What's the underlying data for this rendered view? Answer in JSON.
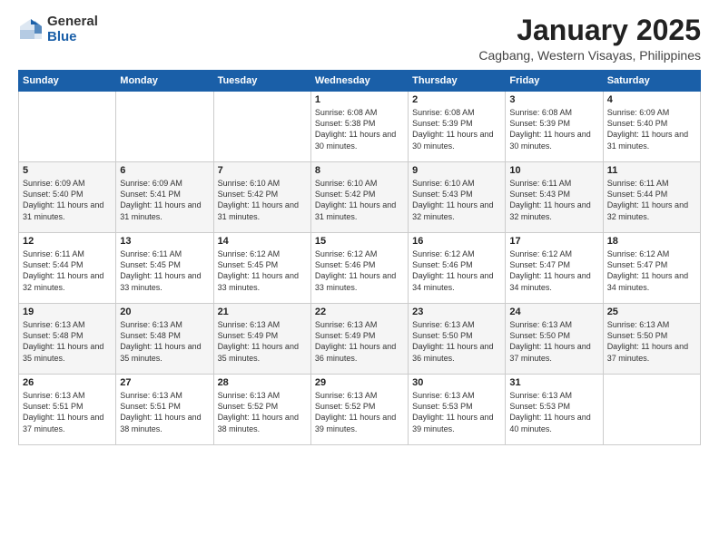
{
  "header": {
    "logo_general": "General",
    "logo_blue": "Blue",
    "month_title": "January 2025",
    "location": "Cagbang, Western Visayas, Philippines"
  },
  "weekdays": [
    "Sunday",
    "Monday",
    "Tuesday",
    "Wednesday",
    "Thursday",
    "Friday",
    "Saturday"
  ],
  "weeks": [
    [
      {
        "day": "",
        "sunrise": "",
        "sunset": "",
        "daylight": ""
      },
      {
        "day": "",
        "sunrise": "",
        "sunset": "",
        "daylight": ""
      },
      {
        "day": "",
        "sunrise": "",
        "sunset": "",
        "daylight": ""
      },
      {
        "day": "1",
        "sunrise": "Sunrise: 6:08 AM",
        "sunset": "Sunset: 5:38 PM",
        "daylight": "Daylight: 11 hours and 30 minutes."
      },
      {
        "day": "2",
        "sunrise": "Sunrise: 6:08 AM",
        "sunset": "Sunset: 5:39 PM",
        "daylight": "Daylight: 11 hours and 30 minutes."
      },
      {
        "day": "3",
        "sunrise": "Sunrise: 6:08 AM",
        "sunset": "Sunset: 5:39 PM",
        "daylight": "Daylight: 11 hours and 30 minutes."
      },
      {
        "day": "4",
        "sunrise": "Sunrise: 6:09 AM",
        "sunset": "Sunset: 5:40 PM",
        "daylight": "Daylight: 11 hours and 31 minutes."
      }
    ],
    [
      {
        "day": "5",
        "sunrise": "Sunrise: 6:09 AM",
        "sunset": "Sunset: 5:40 PM",
        "daylight": "Daylight: 11 hours and 31 minutes."
      },
      {
        "day": "6",
        "sunrise": "Sunrise: 6:09 AM",
        "sunset": "Sunset: 5:41 PM",
        "daylight": "Daylight: 11 hours and 31 minutes."
      },
      {
        "day": "7",
        "sunrise": "Sunrise: 6:10 AM",
        "sunset": "Sunset: 5:42 PM",
        "daylight": "Daylight: 11 hours and 31 minutes."
      },
      {
        "day": "8",
        "sunrise": "Sunrise: 6:10 AM",
        "sunset": "Sunset: 5:42 PM",
        "daylight": "Daylight: 11 hours and 31 minutes."
      },
      {
        "day": "9",
        "sunrise": "Sunrise: 6:10 AM",
        "sunset": "Sunset: 5:43 PM",
        "daylight": "Daylight: 11 hours and 32 minutes."
      },
      {
        "day": "10",
        "sunrise": "Sunrise: 6:11 AM",
        "sunset": "Sunset: 5:43 PM",
        "daylight": "Daylight: 11 hours and 32 minutes."
      },
      {
        "day": "11",
        "sunrise": "Sunrise: 6:11 AM",
        "sunset": "Sunset: 5:44 PM",
        "daylight": "Daylight: 11 hours and 32 minutes."
      }
    ],
    [
      {
        "day": "12",
        "sunrise": "Sunrise: 6:11 AM",
        "sunset": "Sunset: 5:44 PM",
        "daylight": "Daylight: 11 hours and 32 minutes."
      },
      {
        "day": "13",
        "sunrise": "Sunrise: 6:11 AM",
        "sunset": "Sunset: 5:45 PM",
        "daylight": "Daylight: 11 hours and 33 minutes."
      },
      {
        "day": "14",
        "sunrise": "Sunrise: 6:12 AM",
        "sunset": "Sunset: 5:45 PM",
        "daylight": "Daylight: 11 hours and 33 minutes."
      },
      {
        "day": "15",
        "sunrise": "Sunrise: 6:12 AM",
        "sunset": "Sunset: 5:46 PM",
        "daylight": "Daylight: 11 hours and 33 minutes."
      },
      {
        "day": "16",
        "sunrise": "Sunrise: 6:12 AM",
        "sunset": "Sunset: 5:46 PM",
        "daylight": "Daylight: 11 hours and 34 minutes."
      },
      {
        "day": "17",
        "sunrise": "Sunrise: 6:12 AM",
        "sunset": "Sunset: 5:47 PM",
        "daylight": "Daylight: 11 hours and 34 minutes."
      },
      {
        "day": "18",
        "sunrise": "Sunrise: 6:12 AM",
        "sunset": "Sunset: 5:47 PM",
        "daylight": "Daylight: 11 hours and 34 minutes."
      }
    ],
    [
      {
        "day": "19",
        "sunrise": "Sunrise: 6:13 AM",
        "sunset": "Sunset: 5:48 PM",
        "daylight": "Daylight: 11 hours and 35 minutes."
      },
      {
        "day": "20",
        "sunrise": "Sunrise: 6:13 AM",
        "sunset": "Sunset: 5:48 PM",
        "daylight": "Daylight: 11 hours and 35 minutes."
      },
      {
        "day": "21",
        "sunrise": "Sunrise: 6:13 AM",
        "sunset": "Sunset: 5:49 PM",
        "daylight": "Daylight: 11 hours and 35 minutes."
      },
      {
        "day": "22",
        "sunrise": "Sunrise: 6:13 AM",
        "sunset": "Sunset: 5:49 PM",
        "daylight": "Daylight: 11 hours and 36 minutes."
      },
      {
        "day": "23",
        "sunrise": "Sunrise: 6:13 AM",
        "sunset": "Sunset: 5:50 PM",
        "daylight": "Daylight: 11 hours and 36 minutes."
      },
      {
        "day": "24",
        "sunrise": "Sunrise: 6:13 AM",
        "sunset": "Sunset: 5:50 PM",
        "daylight": "Daylight: 11 hours and 37 minutes."
      },
      {
        "day": "25",
        "sunrise": "Sunrise: 6:13 AM",
        "sunset": "Sunset: 5:50 PM",
        "daylight": "Daylight: 11 hours and 37 minutes."
      }
    ],
    [
      {
        "day": "26",
        "sunrise": "Sunrise: 6:13 AM",
        "sunset": "Sunset: 5:51 PM",
        "daylight": "Daylight: 11 hours and 37 minutes."
      },
      {
        "day": "27",
        "sunrise": "Sunrise: 6:13 AM",
        "sunset": "Sunset: 5:51 PM",
        "daylight": "Daylight: 11 hours and 38 minutes."
      },
      {
        "day": "28",
        "sunrise": "Sunrise: 6:13 AM",
        "sunset": "Sunset: 5:52 PM",
        "daylight": "Daylight: 11 hours and 38 minutes."
      },
      {
        "day": "29",
        "sunrise": "Sunrise: 6:13 AM",
        "sunset": "Sunset: 5:52 PM",
        "daylight": "Daylight: 11 hours and 39 minutes."
      },
      {
        "day": "30",
        "sunrise": "Sunrise: 6:13 AM",
        "sunset": "Sunset: 5:53 PM",
        "daylight": "Daylight: 11 hours and 39 minutes."
      },
      {
        "day": "31",
        "sunrise": "Sunrise: 6:13 AM",
        "sunset": "Sunset: 5:53 PM",
        "daylight": "Daylight: 11 hours and 40 minutes."
      },
      {
        "day": "",
        "sunrise": "",
        "sunset": "",
        "daylight": ""
      }
    ]
  ]
}
